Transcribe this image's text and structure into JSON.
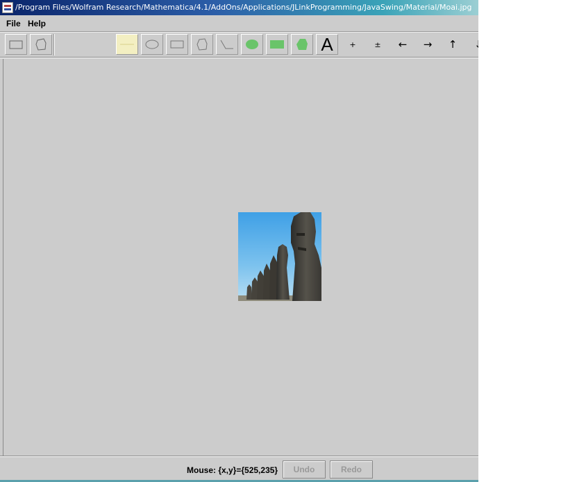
{
  "window": {
    "title": "/Program Files/Wolfram Research/Mathematica/4.1/AddOns/Applications/JLinkProgramming/JavaSwing/Material/Moai.jpg"
  },
  "menu": {
    "file": "File",
    "help": "Help"
  },
  "toolbar": {
    "tools": [
      {
        "name": "select-rectangle",
        "icon": "rectangle-outline-icon"
      },
      {
        "name": "select-freeform",
        "icon": "freeform-outline-icon"
      },
      {
        "name": "line",
        "icon": "line-icon",
        "selected": true
      },
      {
        "name": "ellipse",
        "icon": "ellipse-outline-icon"
      },
      {
        "name": "rectangle",
        "icon": "rectangle-outline-icon"
      },
      {
        "name": "polygon",
        "icon": "polygon-outline-icon"
      },
      {
        "name": "polyline",
        "icon": "polyline-icon"
      },
      {
        "name": "filled-ellipse",
        "icon": "filled-ellipse-icon"
      },
      {
        "name": "filled-rectangle",
        "icon": "filled-rectangle-icon"
      },
      {
        "name": "filled-polygon",
        "icon": "filled-polygon-icon"
      },
      {
        "name": "text",
        "icon": "text-icon"
      }
    ],
    "text_tool_glyph": "A",
    "actions": {
      "plus": "+",
      "plus_minus": "±",
      "left": "←",
      "right": "→",
      "up": "↑",
      "down": "↓"
    },
    "fill_color": "#6ac46a",
    "selected_color": "#f3efc2"
  },
  "canvas": {
    "image_alt": "Moai statues photo"
  },
  "status": {
    "mouse_text": "Mouse: {x,y}={525,235}",
    "undo_label": "Undo",
    "redo_label": "Redo"
  }
}
